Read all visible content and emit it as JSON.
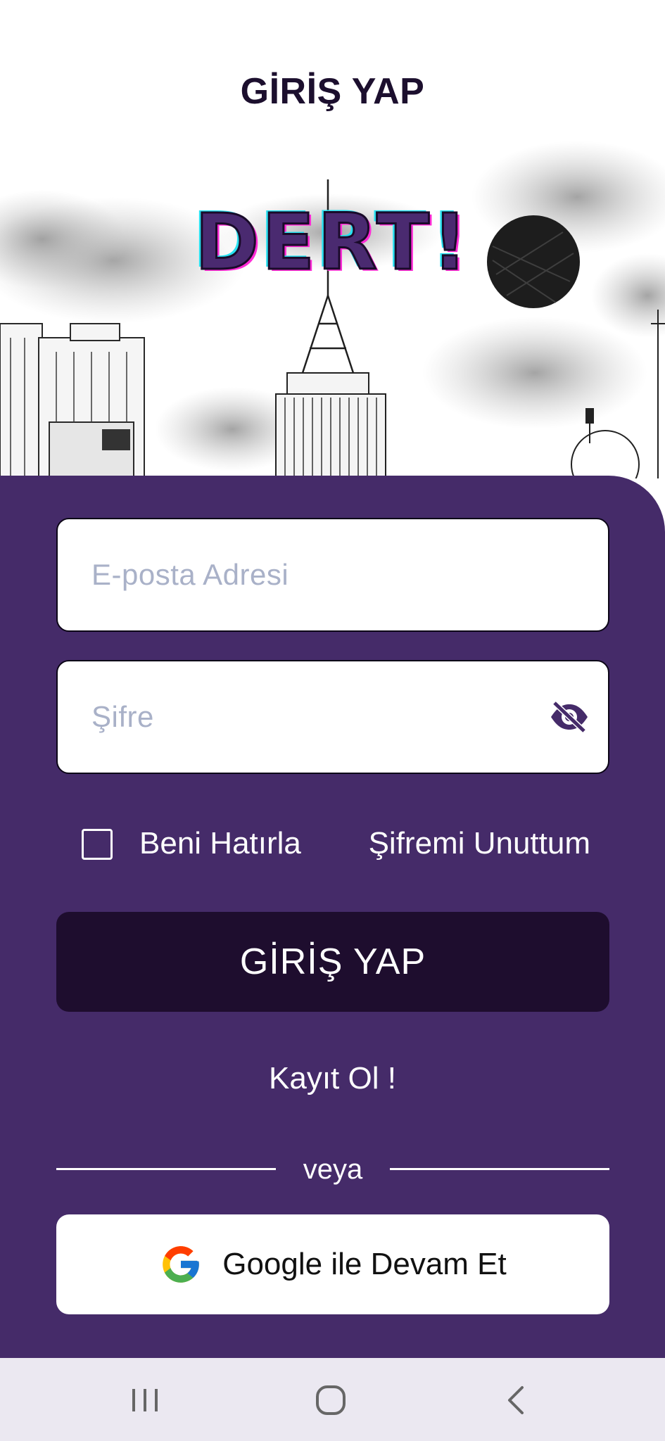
{
  "header": {
    "title": "GİRİŞ YAP"
  },
  "logo": {
    "text": "DERT!"
  },
  "form": {
    "email_placeholder": "E-posta Adresi",
    "password_placeholder": "Şifre",
    "remember_label": "Beni Hatırla",
    "remember_checked": false,
    "forgot_label": "Şifremi Unuttum",
    "login_label": "GİRİŞ YAP",
    "register_label": "Kayıt Ol !",
    "divider_label": "veya",
    "google_label": "Google ile Devam Et"
  },
  "icons": {
    "password_toggle": "eye-off-icon",
    "google": "google-icon",
    "nav_recents": "recents-icon",
    "nav_home": "home-icon",
    "nav_back": "back-icon"
  },
  "colors": {
    "panel": "#452b69",
    "primary_button": "#1e0d2e",
    "title": "#1c0f2e",
    "placeholder": "#a9b1c8",
    "navbar": "#ebe8f1"
  }
}
